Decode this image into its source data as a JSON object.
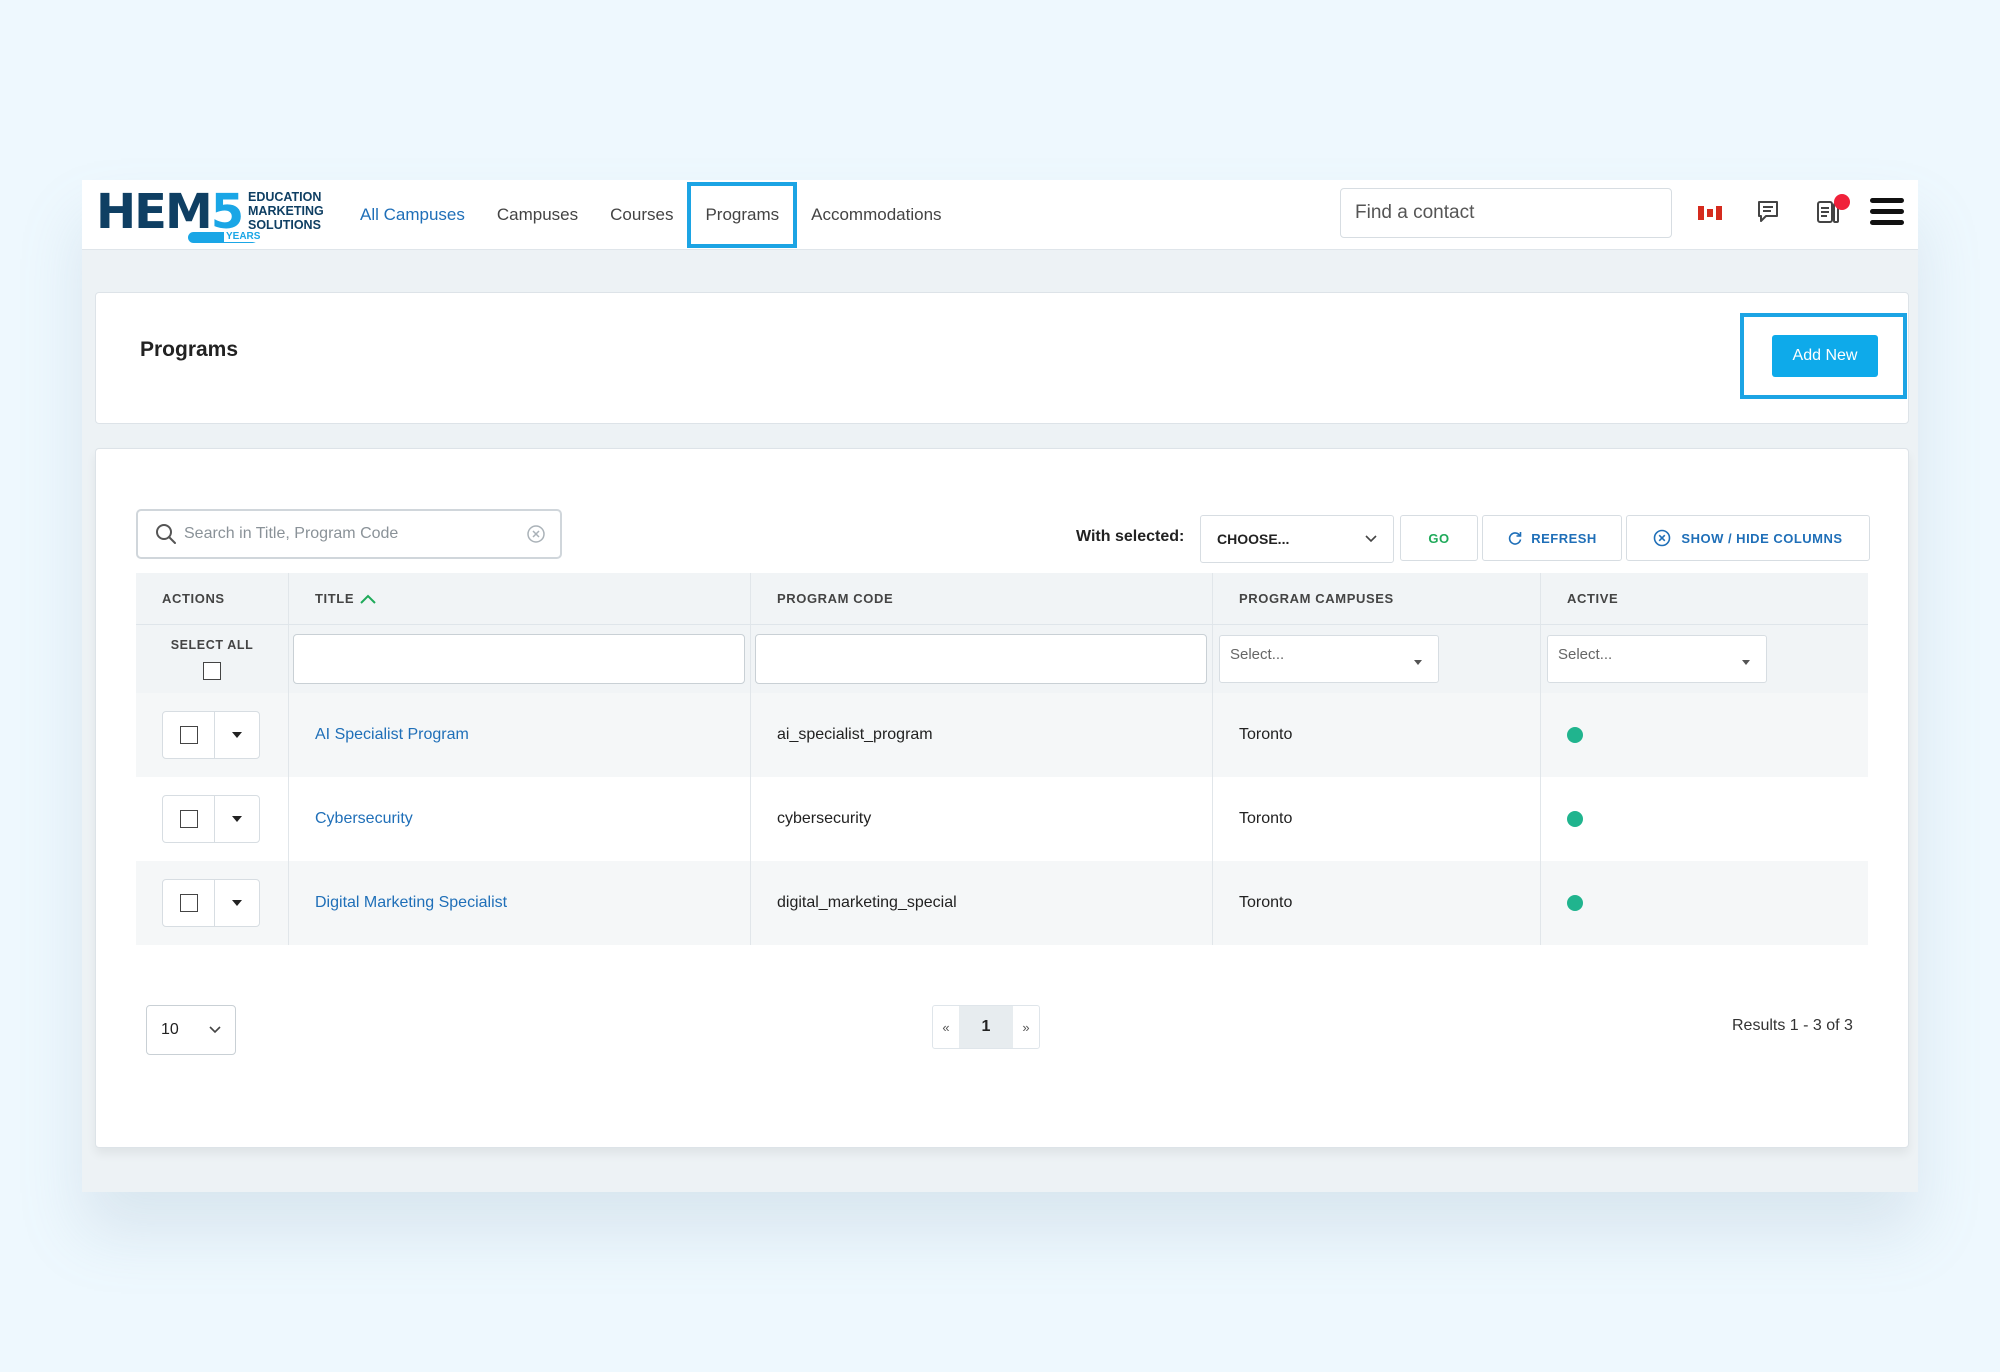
{
  "logo": {
    "main_prefix": "HEM",
    "main_suffix": "5",
    "line1": "EDUCATION",
    "line2": "MARKETING",
    "line3": "SOLUTIONS",
    "years": "YEARS"
  },
  "nav": {
    "items": [
      {
        "label": "All Campuses"
      },
      {
        "label": "Campuses"
      },
      {
        "label": "Courses"
      },
      {
        "label": "Programs"
      },
      {
        "label": "Accommodations"
      }
    ],
    "search_placeholder": "Find a contact"
  },
  "header": {
    "title": "Programs",
    "add_new_label": "Add New"
  },
  "toolbar": {
    "search_placeholder": "Search in Title, Program Code",
    "with_selected_label": "With selected:",
    "choose_label": "CHOOSE...",
    "go_label": "GO",
    "refresh_label": "REFRESH",
    "columns_label": "SHOW / HIDE COLUMNS"
  },
  "table": {
    "columns": [
      "ACTIONS",
      "TITLE",
      "PROGRAM CODE",
      "PROGRAM CAMPUSES",
      "ACTIVE"
    ],
    "select_all_label": "SELECT ALL",
    "filter_select_placeholder": "Select...",
    "rows": [
      {
        "title": "AI Specialist Program",
        "code": "ai_specialist_program",
        "campus": "Toronto",
        "active": true
      },
      {
        "title": "Cybersecurity",
        "code": "cybersecurity",
        "campus": "Toronto",
        "active": true
      },
      {
        "title": "Digital Marketing Specialist",
        "code": "digital_marketing_special",
        "campus": "Toronto",
        "active": true
      }
    ]
  },
  "footer": {
    "page_size": "10",
    "prev": "«",
    "current_page": "1",
    "next": "»",
    "results_text": "Results 1 - 3 of 3"
  },
  "colors": {
    "accent": "#1ca4e4",
    "add_button": "#0eaaea",
    "link": "#1f6fb8",
    "go": "#1faa5a",
    "active_dot": "#20b48e",
    "notification": "#f0213a"
  },
  "icons": [
    "canada-flag-icon",
    "chat-icon",
    "notes-icon",
    "hamburger-menu-icon",
    "search-icon",
    "clear-icon",
    "chevron-down-icon",
    "refresh-icon",
    "circle-x-icon",
    "sort-up-icon",
    "caret-down-icon"
  ]
}
